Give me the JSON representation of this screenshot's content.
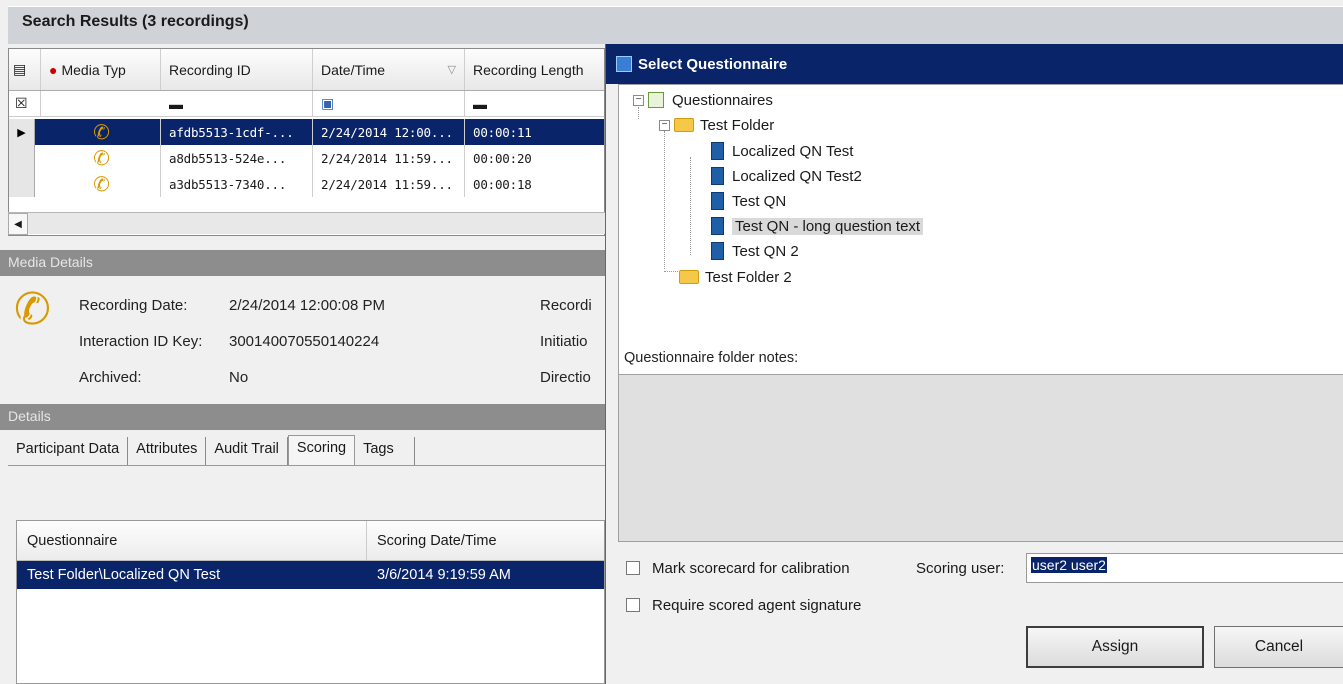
{
  "search_results": {
    "title": "Search Results (3 recordings)",
    "columns": [
      "Media Typ",
      "Recording ID",
      "Date/Time",
      "Recording Length"
    ],
    "rows": [
      {
        "id": "afdb5513-1cdf-...",
        "datetime": "2/24/2014  12:00...",
        "length": "00:00:11",
        "selected": true
      },
      {
        "id": "a8db5513-524e...",
        "datetime": "2/24/2014  11:59...",
        "length": "00:00:20",
        "selected": false
      },
      {
        "id": "a3db5513-7340...",
        "datetime": "2/24/2014  11:59...",
        "length": "00:00:18",
        "selected": false
      }
    ]
  },
  "media_details": {
    "section_title": "Media Details",
    "recording_date_label": "Recording Date:",
    "recording_date_value": "2/24/2014 12:00:08 PM",
    "interaction_label": "Interaction ID Key:",
    "interaction_value": "300140070550140224",
    "archived_label": "Archived:",
    "archived_value": "No",
    "right_labels": [
      "Recordi",
      "Initiatio",
      "Directio"
    ]
  },
  "details": {
    "section_title": "Details",
    "tabs": [
      "Participant Data",
      "Attributes",
      "Audit Trail",
      "Scoring",
      "Tags"
    ],
    "active_tab": "Scoring",
    "scoring_columns": [
      "Questionnaire",
      "Scoring Date/Time"
    ],
    "scoring_rows": [
      {
        "questionnaire": "Test Folder\\Localized QN Test",
        "datetime": "3/6/2014 9:19:59 AM"
      }
    ]
  },
  "dialog": {
    "title": "Select Questionnaire",
    "tree": {
      "root": "Questionnaires",
      "folder1": "Test Folder",
      "items": [
        "Localized QN Test",
        "Localized QN Test2",
        "Test QN",
        "Test QN - long question text",
        "Test QN 2"
      ],
      "selected_item": "Test QN - long question text",
      "folder2": "Test Folder 2"
    },
    "notes_label": "Questionnaire folder notes:",
    "calibration_label": "Mark scorecard for calibration",
    "signature_label": "Require scored agent signature",
    "scoring_user_label": "Scoring user:",
    "scoring_user_value": "user2 user2",
    "assign_label": "Assign",
    "cancel_label": "Cancel"
  }
}
